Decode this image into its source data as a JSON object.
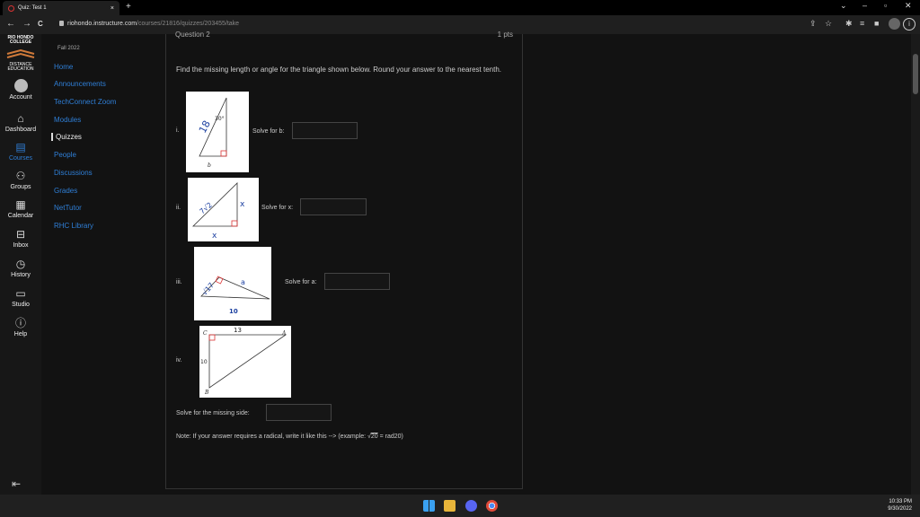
{
  "browser": {
    "tab_title": "Quiz: Test 1",
    "tab_close": "×",
    "new_tab": "+",
    "url_host": "riohondo.instructure.com",
    "url_path": "/courses/21816/quizzes/203455/take",
    "back": "←",
    "forward": "→",
    "reload": "C"
  },
  "global_nav": {
    "logo_top": "RIO HONDO COLLEGE",
    "logo_bottom": "DISTANCE EDUCATION",
    "items": [
      {
        "label": "Account",
        "icon": "avatar-icon"
      },
      {
        "label": "Dashboard",
        "icon": "dashboard-icon"
      },
      {
        "label": "Courses",
        "icon": "courses-icon"
      },
      {
        "label": "Groups",
        "icon": "groups-icon"
      },
      {
        "label": "Calendar",
        "icon": "calendar-icon"
      },
      {
        "label": "Inbox",
        "icon": "inbox-icon"
      },
      {
        "label": "History",
        "icon": "history-icon"
      },
      {
        "label": "Studio",
        "icon": "studio-icon"
      },
      {
        "label": "Help",
        "icon": "help-icon"
      }
    ],
    "collapse_icon": "⇤"
  },
  "course_nav": {
    "term": "Fall 2022",
    "items": [
      {
        "label": "Home"
      },
      {
        "label": "Announcements"
      },
      {
        "label": "TechConnect Zoom"
      },
      {
        "label": "Modules"
      },
      {
        "label": "Quizzes"
      },
      {
        "label": "People"
      },
      {
        "label": "Discussions"
      },
      {
        "label": "Grades"
      },
      {
        "label": "NetTutor"
      },
      {
        "label": "RHC Library"
      }
    ]
  },
  "question": {
    "header": "Question 2",
    "points": "1 pts",
    "prompt": "Find the missing length or angle for the triangle shown below. Round your answer to the nearest tenth.",
    "parts": [
      {
        "num": "i.",
        "solve": "Solve for b:",
        "fig_hyp": "18",
        "fig_angle": "30°",
        "fig_base": "b"
      },
      {
        "num": "ii.",
        "solve": "Solve for x:",
        "fig_hyp": "7√2",
        "fig_side": "x",
        "fig_base": "x"
      },
      {
        "num": "iii.",
        "solve": "Solve for a:",
        "fig_short": "√17",
        "fig_side": "a",
        "fig_base": "10"
      },
      {
        "num": "iv.",
        "fig_c": "C",
        "fig_top": "13",
        "fig_a": "A",
        "fig_left": "10",
        "fig_b": "B"
      }
    ],
    "missing_side_label": "Solve for the missing side:",
    "note_prefix": "Note: If your answer requires a radical, write it like this --> (example: √",
    "note_rad": "20",
    "note_suffix": " = rad20)"
  },
  "taskbar": {
    "time": "10:33 PM",
    "date": "9/30/2022"
  }
}
